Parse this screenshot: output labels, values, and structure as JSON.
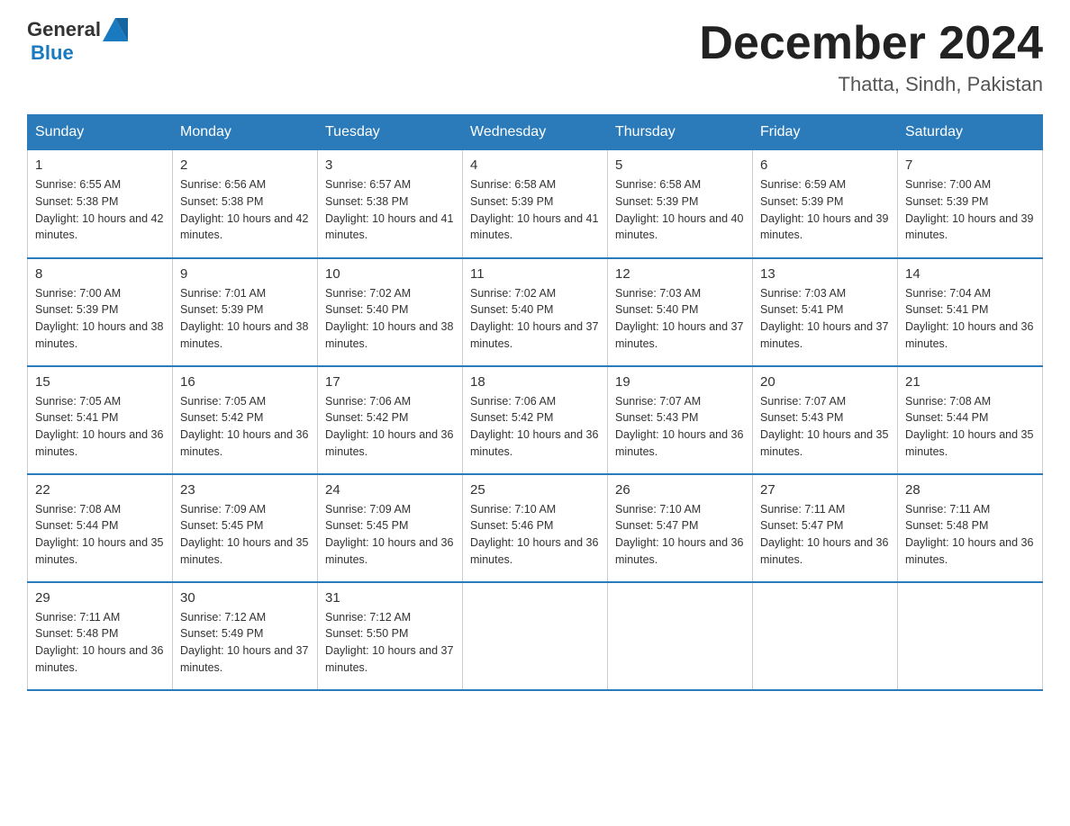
{
  "logo": {
    "text_general": "General",
    "text_blue": "Blue"
  },
  "header": {
    "month": "December 2024",
    "location": "Thatta, Sindh, Pakistan"
  },
  "days_of_week": [
    "Sunday",
    "Monday",
    "Tuesday",
    "Wednesday",
    "Thursday",
    "Friday",
    "Saturday"
  ],
  "weeks": [
    [
      {
        "day": "1",
        "sunrise": "6:55 AM",
        "sunset": "5:38 PM",
        "daylight": "10 hours and 42 minutes."
      },
      {
        "day": "2",
        "sunrise": "6:56 AM",
        "sunset": "5:38 PM",
        "daylight": "10 hours and 42 minutes."
      },
      {
        "day": "3",
        "sunrise": "6:57 AM",
        "sunset": "5:38 PM",
        "daylight": "10 hours and 41 minutes."
      },
      {
        "day": "4",
        "sunrise": "6:58 AM",
        "sunset": "5:39 PM",
        "daylight": "10 hours and 41 minutes."
      },
      {
        "day": "5",
        "sunrise": "6:58 AM",
        "sunset": "5:39 PM",
        "daylight": "10 hours and 40 minutes."
      },
      {
        "day": "6",
        "sunrise": "6:59 AM",
        "sunset": "5:39 PM",
        "daylight": "10 hours and 39 minutes."
      },
      {
        "day": "7",
        "sunrise": "7:00 AM",
        "sunset": "5:39 PM",
        "daylight": "10 hours and 39 minutes."
      }
    ],
    [
      {
        "day": "8",
        "sunrise": "7:00 AM",
        "sunset": "5:39 PM",
        "daylight": "10 hours and 38 minutes."
      },
      {
        "day": "9",
        "sunrise": "7:01 AM",
        "sunset": "5:39 PM",
        "daylight": "10 hours and 38 minutes."
      },
      {
        "day": "10",
        "sunrise": "7:02 AM",
        "sunset": "5:40 PM",
        "daylight": "10 hours and 38 minutes."
      },
      {
        "day": "11",
        "sunrise": "7:02 AM",
        "sunset": "5:40 PM",
        "daylight": "10 hours and 37 minutes."
      },
      {
        "day": "12",
        "sunrise": "7:03 AM",
        "sunset": "5:40 PM",
        "daylight": "10 hours and 37 minutes."
      },
      {
        "day": "13",
        "sunrise": "7:03 AM",
        "sunset": "5:41 PM",
        "daylight": "10 hours and 37 minutes."
      },
      {
        "day": "14",
        "sunrise": "7:04 AM",
        "sunset": "5:41 PM",
        "daylight": "10 hours and 36 minutes."
      }
    ],
    [
      {
        "day": "15",
        "sunrise": "7:05 AM",
        "sunset": "5:41 PM",
        "daylight": "10 hours and 36 minutes."
      },
      {
        "day": "16",
        "sunrise": "7:05 AM",
        "sunset": "5:42 PM",
        "daylight": "10 hours and 36 minutes."
      },
      {
        "day": "17",
        "sunrise": "7:06 AM",
        "sunset": "5:42 PM",
        "daylight": "10 hours and 36 minutes."
      },
      {
        "day": "18",
        "sunrise": "7:06 AM",
        "sunset": "5:42 PM",
        "daylight": "10 hours and 36 minutes."
      },
      {
        "day": "19",
        "sunrise": "7:07 AM",
        "sunset": "5:43 PM",
        "daylight": "10 hours and 36 minutes."
      },
      {
        "day": "20",
        "sunrise": "7:07 AM",
        "sunset": "5:43 PM",
        "daylight": "10 hours and 35 minutes."
      },
      {
        "day": "21",
        "sunrise": "7:08 AM",
        "sunset": "5:44 PM",
        "daylight": "10 hours and 35 minutes."
      }
    ],
    [
      {
        "day": "22",
        "sunrise": "7:08 AM",
        "sunset": "5:44 PM",
        "daylight": "10 hours and 35 minutes."
      },
      {
        "day": "23",
        "sunrise": "7:09 AM",
        "sunset": "5:45 PM",
        "daylight": "10 hours and 35 minutes."
      },
      {
        "day": "24",
        "sunrise": "7:09 AM",
        "sunset": "5:45 PM",
        "daylight": "10 hours and 36 minutes."
      },
      {
        "day": "25",
        "sunrise": "7:10 AM",
        "sunset": "5:46 PM",
        "daylight": "10 hours and 36 minutes."
      },
      {
        "day": "26",
        "sunrise": "7:10 AM",
        "sunset": "5:47 PM",
        "daylight": "10 hours and 36 minutes."
      },
      {
        "day": "27",
        "sunrise": "7:11 AM",
        "sunset": "5:47 PM",
        "daylight": "10 hours and 36 minutes."
      },
      {
        "day": "28",
        "sunrise": "7:11 AM",
        "sunset": "5:48 PM",
        "daylight": "10 hours and 36 minutes."
      }
    ],
    [
      {
        "day": "29",
        "sunrise": "7:11 AM",
        "sunset": "5:48 PM",
        "daylight": "10 hours and 36 minutes."
      },
      {
        "day": "30",
        "sunrise": "7:12 AM",
        "sunset": "5:49 PM",
        "daylight": "10 hours and 37 minutes."
      },
      {
        "day": "31",
        "sunrise": "7:12 AM",
        "sunset": "5:50 PM",
        "daylight": "10 hours and 37 minutes."
      },
      null,
      null,
      null,
      null
    ]
  ],
  "labels": {
    "sunrise": "Sunrise:",
    "sunset": "Sunset:",
    "daylight": "Daylight:"
  }
}
